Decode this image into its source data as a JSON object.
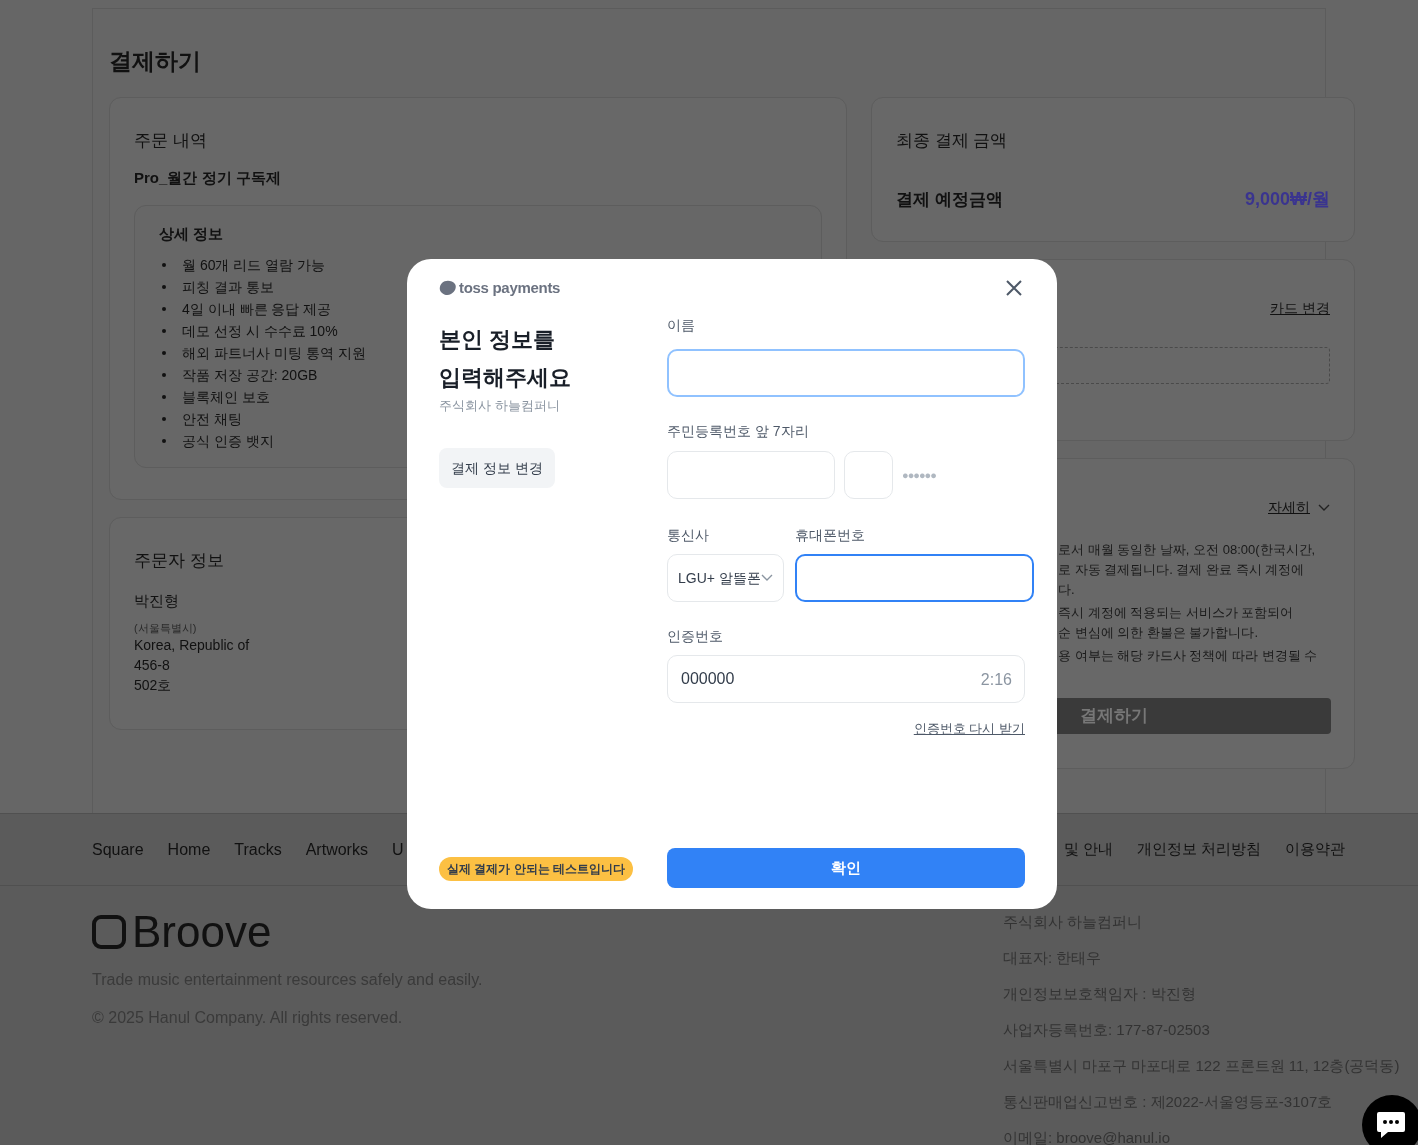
{
  "page": {
    "title": "결제하기"
  },
  "order_card": {
    "heading": "주문 내역",
    "product": "Pro_월간 정기 구독제",
    "details": {
      "heading": "상세 정보",
      "items": [
        "월 60개 리드 열람 가능",
        "피칭 결과 통보",
        "4일 이내 빠른 응답 제공",
        "데모 선정 시 수수료 10%",
        "해외 파트너사 미팅 통역 지원",
        "작품 저장 공간: 20GB",
        "블록체인 보호",
        "안전 채팅",
        "공식 인증 뱃지"
      ]
    }
  },
  "orderer_card": {
    "heading": "주문자 정보",
    "name": "박진형",
    "region": "(서울특별시)",
    "address_lines": [
      "Korea, Republic of",
      "456-8",
      "502호"
    ]
  },
  "total_card": {
    "heading": "최종 결제 금액",
    "label": "결제 예정금액",
    "amount": "9,000₩/월"
  },
  "card_method": {
    "change_link": "카드 변경"
  },
  "notice_card": {
    "more_link": "자세히",
    "paragraphs": [
      [
        "로서 매월 동일한 날짜, 오전 08:00(한국시간,",
        "로 자동 결제됩니다. 결제 완료 즉시 계정에",
        "다."
      ],
      [
        "즉시 계정에 적용되는 서비스가 포함되어",
        "순 변심에 의한 환불은 불가합니다."
      ],
      [
        "용 여부는 해당 카드사 정책에 따라 변경될 수"
      ]
    ],
    "pay_button": "결제하기"
  },
  "footer_nav": {
    "left": [
      "Square",
      "Home",
      "Tracks",
      "Artworks",
      "U"
    ],
    "right": [
      "및 안내",
      "개인정보 처리방침",
      "이용약관"
    ]
  },
  "footer": {
    "brand": "Broove",
    "tagline": "Trade music entertainment resources safely and easily.",
    "copyright": "© 2025 Hanul Company. All rights reserved.",
    "company_info": [
      "주식회사 하늘컴퍼니",
      "대표자: 한태우",
      "개인정보보호책임자 : 박진형",
      "사업자등록번호: 177-87-02503",
      "서울특별시 마포구 마포대로 122 프론트원 11, 12층(공덕동)",
      "통신판매업신고번호 : 제2022-서울영등포-3107호",
      "이메일: broove@hanul.io"
    ]
  },
  "modal": {
    "brand": "toss payments",
    "title_lines": [
      "본인 정보를",
      "입력해주세요"
    ],
    "merchant": "주식회사 하늘컴퍼니",
    "change_button": "결제 정보 변경",
    "test_badge": "실제 결제가 안되는 테스트입니다",
    "name_field": {
      "label": "이름",
      "hovered": true,
      "focused": false
    },
    "rrn_field": {
      "label": "주민등록번호 앞 7자리",
      "mask": "●●●●●●"
    },
    "carrier_field": {
      "label": "통신사",
      "value": "LGU+ 알뜰폰"
    },
    "phone_field": {
      "label": "휴대폰번호",
      "hovered": false,
      "focused": true
    },
    "code_field": {
      "label": "인증번호",
      "value": "000000",
      "timer": "2:16"
    },
    "resend_link": "인증번호 다시 받기",
    "confirm_button": "확인"
  }
}
